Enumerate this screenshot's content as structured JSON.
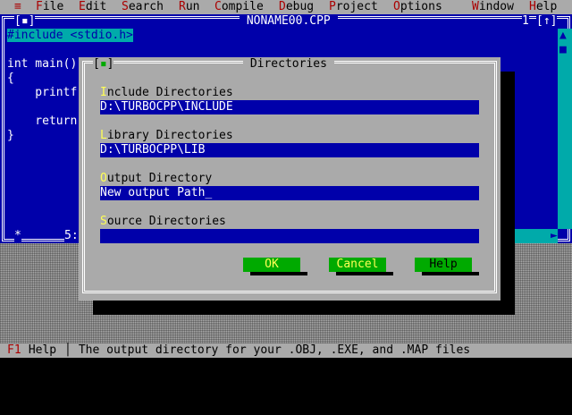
{
  "menu": {
    "system": "≡",
    "items": [
      {
        "hot": "F",
        "rest": "ile"
      },
      {
        "hot": "E",
        "rest": "dit"
      },
      {
        "hot": "S",
        "rest": "earch"
      },
      {
        "hot": "R",
        "rest": "un"
      },
      {
        "hot": "C",
        "rest": "ompile"
      },
      {
        "hot": "D",
        "rest": "ebug"
      },
      {
        "hot": "P",
        "rest": "roject"
      },
      {
        "hot": "O",
        "rest": "ptions"
      },
      {
        "hot": "W",
        "rest": "indow"
      },
      {
        "hot": "H",
        "rest": "elp"
      }
    ]
  },
  "editor": {
    "title": " NONAME00.CPP ",
    "close_box": "[▪]",
    "window_number": "1",
    "zoom_box": "[↑]",
    "lines": [
      "#include <stdio.h>",
      "",
      "int main()",
      "{",
      "    printf",
      "",
      "    return",
      "}"
    ],
    "cursor_pos": "5:",
    "scroll_up": "▲",
    "scroll_thumb": "■",
    "scroll_right": "►"
  },
  "dialog": {
    "title": " Directories ",
    "close_box": "[▪]",
    "fields": [
      {
        "hot": "I",
        "label_rest": "nclude Directories",
        "value": " D:\\TURBOCPP\\INCLUDE"
      },
      {
        "hot": "L",
        "label_rest": "ibrary Directories",
        "value": " D:\\TURBOCPP\\LIB"
      },
      {
        "hot": "O",
        "label_rest": "utput Directory",
        "value": " New output Path_"
      },
      {
        "hot": "S",
        "label_rest": "ource Directories",
        "value": ""
      }
    ],
    "buttons": {
      "ok": "OK",
      "cancel": "Cancel",
      "help": "Help"
    }
  },
  "status": {
    "key": "F1",
    "key_label": " Help",
    "separator": "│",
    "hint": " The output directory for your .OBJ, .EXE, and .MAP files"
  },
  "colors": {
    "blue": "#0000aa",
    "cyan": "#00aaaa",
    "gray": "#aaaaaa",
    "green": "#00aa00",
    "yellow": "#ffff55",
    "hot_red": "#aa0000"
  }
}
